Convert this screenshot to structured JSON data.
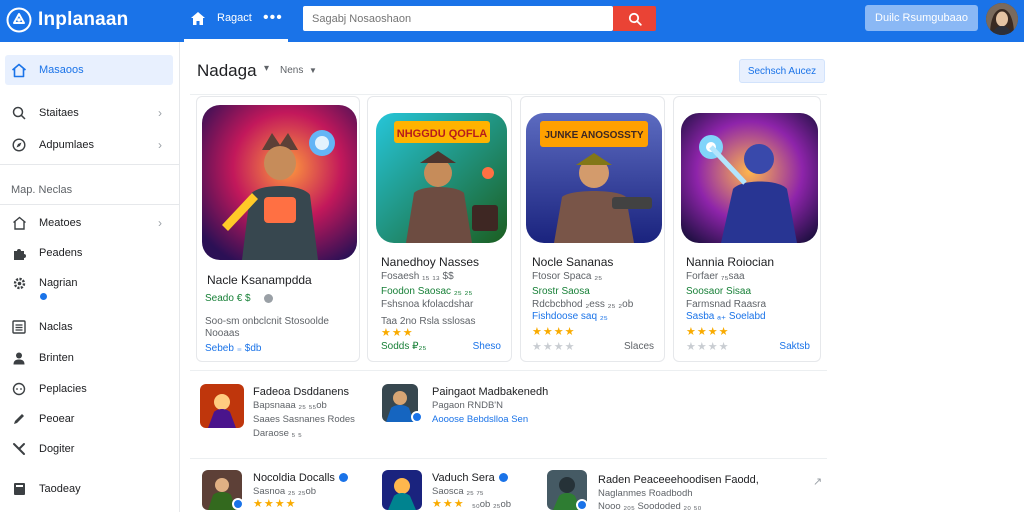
{
  "app": {
    "name": "Inplanaan"
  },
  "topbar": {
    "nav_label": "Ragact",
    "more_label": "•••",
    "search_placeholder": "Sagabj Nosaoshaon",
    "cta_label": "Duilc Rsumgubaao",
    "colors": {
      "bar": "#1a73e8",
      "search_button": "#ea4335"
    }
  },
  "sidebar": {
    "items_top": [
      {
        "label": "Masaoos",
        "icon": "home-icon",
        "active": true
      },
      {
        "label": "Staitaes",
        "icon": "search-icon",
        "chevron": true
      },
      {
        "label": "Adpumlaes",
        "icon": "compass-icon",
        "chevron": true
      }
    ],
    "section_heading": "Map. Neclas",
    "items_bottom": [
      {
        "label": "Meatoes",
        "icon": "home-outline-icon",
        "chevron": true
      },
      {
        "label": "Peadens",
        "icon": "puzzle-icon"
      },
      {
        "label": "Nagrian",
        "icon": "gear-icon",
        "dot": true
      },
      {
        "label": "Naclas",
        "icon": "list-icon"
      },
      {
        "label": "Brinten",
        "icon": "person-icon"
      },
      {
        "label": "Peplacies",
        "icon": "chat-icon"
      },
      {
        "label": "Peoear",
        "icon": "pen-icon"
      },
      {
        "label": "Dogiter",
        "icon": "tools-icon"
      },
      {
        "label": "Taodeay",
        "icon": "book-icon"
      }
    ]
  },
  "main": {
    "title": "Nadaga",
    "filter_label": "Nens",
    "header_button": "Sechsch Aucez",
    "cards": [
      {
        "title": "Nacle Ksanampdda",
        "meta1": "Seado  € $",
        "meta2": "Soo-sm  onbclcnit Stosoolde",
        "meta3": "Nooaas",
        "meta4": "Sebeb  ₌  $db",
        "stars": 0,
        "link": "",
        "art_label": ""
      },
      {
        "title": "Nanedhoy Nasses",
        "meta1": "Fosaesh  ₁₅  ₁₃  $$",
        "meta2": "Foodon  Saosac  ₂₅  ₂₅",
        "meta3": "Fshsnoa  kfolacdshar",
        "meta4": "Taa  2no  Rsla sslosas",
        "stars": 3,
        "link": "Sheso",
        "art_label": "NHGGDU QOFLA"
      },
      {
        "title": "Nocle Sananas",
        "meta1": "Ftosor  Spaca  ₂₅",
        "meta2": "Srostr  Saosa",
        "meta3": "Rdcbcbhod  ₂ess  ₂₅  ₂ob",
        "meta4": "Fishdoose saq  ₂₅",
        "stars": 4,
        "link": "Slaces",
        "art_label": "JUNKE ANOSOSSTY"
      },
      {
        "title": "Nannia Roiocian",
        "meta1": "Forfaer  ₇₅saa",
        "meta2": "Soosaor  Sisaa",
        "meta3": "Farmsnad  Raasra",
        "meta4": "Sasba  ₐ₊  Soelabd",
        "stars": 4,
        "link": "Saktsb",
        "art_label": ""
      }
    ],
    "row1": [
      {
        "title": "Fadeoa Dsddanens",
        "line1": "Bapsnaaa  ₂₅  ₅₅ob",
        "line2": "Saaes  Sasnanes  Rodes",
        "line3": "Daraose  ₅  ₅"
      },
      {
        "title": "Paingaot  Madbakenedh",
        "line1": "Pagaon  RNDB'N",
        "line2": "Aooose  Bebdslloa  Sen",
        "line3": ""
      }
    ],
    "row2": [
      {
        "title": "Nocoldia Docalls",
        "line1": "Sasnoa  ₂₅  ₂₅ob",
        "line2": "",
        "stars": 4
      },
      {
        "title": "Vaduch  Sera",
        "line1": "Saosca  ₂₅  ₇₅",
        "line2": "",
        "stars": 3,
        "extra": "₅₀ob  ₂₅ob"
      },
      {
        "title": "Raden  Peaceeehoodisen  Faodd,",
        "line1": "Naglanmes  Roadbodh",
        "line2": "Nooo  ₂₀₅  Soododed  ₂₀  ₅₀"
      }
    ],
    "row3_arrow": "↗"
  }
}
